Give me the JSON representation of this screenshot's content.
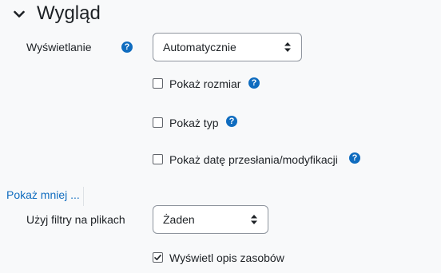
{
  "colors": {
    "accent": "#0f6cbf",
    "help": "#0f6cbf",
    "text": "#1d2125",
    "background": "#f8f9fa"
  },
  "section": {
    "title": "Wygląd",
    "toggle_icon": "chevron-down-icon"
  },
  "display": {
    "label": "Wyświetlanie",
    "help_icon": "question-circle-icon",
    "select_value": "Automatycznie"
  },
  "options": [
    {
      "label": "Pokaż rozmiar",
      "checked": false,
      "help": true
    },
    {
      "label": "Pokaż typ",
      "checked": false,
      "help": true
    },
    {
      "label": "Pokaż datę przesłania/modyfikacji",
      "checked": false,
      "help": true
    }
  ],
  "show_less": {
    "label": "Pokaż mniej ..."
  },
  "filters": {
    "label": "Użyj filtry na plikach",
    "select_value": "Żaden"
  },
  "description": {
    "label": "Wyświetl opis zasobów",
    "checked": true
  }
}
